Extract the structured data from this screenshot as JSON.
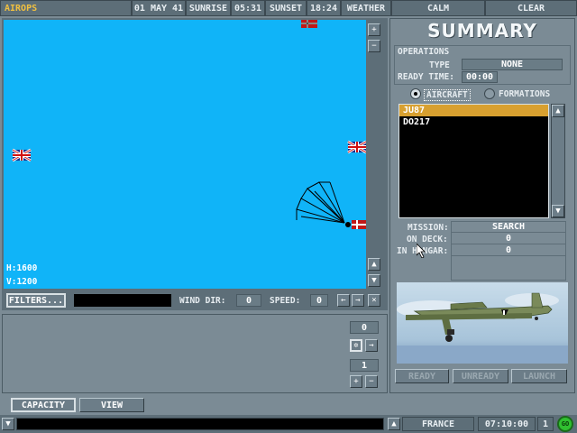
{
  "topbar": {
    "app_label": "AIROPS",
    "date": "01 MAY 41",
    "sunrise_label": "SUNRISE",
    "sunrise_time": "05:31",
    "sunset_label": "SUNSET",
    "sunset_time": "18:24",
    "weather_label": "WEATHER",
    "weather_value": "CALM",
    "clear_label": "CLEAR"
  },
  "map": {
    "h_readout": "H:1600",
    "v_readout": "V:1200",
    "background": "#10b4f8",
    "flags": [
      "union-jack",
      "german-ensign"
    ]
  },
  "map_controls": {
    "filters_label": "FILTERS...",
    "wind_dir_label": "WIND DIR:",
    "wind_dir_value": "0",
    "speed_label": "SPEED:",
    "speed_value": "0",
    "plus": "+",
    "minus": "−",
    "left": "←",
    "right": "→",
    "close": "×"
  },
  "lower_controls": {
    "counter_top": "0",
    "counter_bottom": "1"
  },
  "summary": {
    "title": "SUMMARY",
    "operations_label": "OPERATIONS",
    "type_label": "TYPE",
    "type_value": "NONE",
    "ready_time_label": "READY TIME:",
    "ready_time_value": "00:00",
    "aircraft_label": "AIRCRAFT",
    "formations_label": "FORMATIONS",
    "aircraft_list": [
      "JU87",
      "DO217"
    ],
    "mission_label": "MISSION:",
    "mission_value": "SEARCH",
    "on_deck_label": "ON DECK:",
    "on_deck_value": "0",
    "in_hangar_label": "IN HANGAR:",
    "in_hangar_value": "0",
    "ready_label": "READY",
    "unready_label": "UNREADY",
    "launch_label": "LAUNCH"
  },
  "bottom": {
    "capacity_label": "CAPACITY",
    "view_label": "VIEW",
    "region": "FRANCE",
    "clock": "07:10:00",
    "count": "1",
    "go_label": "GO"
  },
  "colors": {
    "accent_selected": "#d8a030",
    "panel": "#7b8b95",
    "go_green": "#30c030"
  }
}
